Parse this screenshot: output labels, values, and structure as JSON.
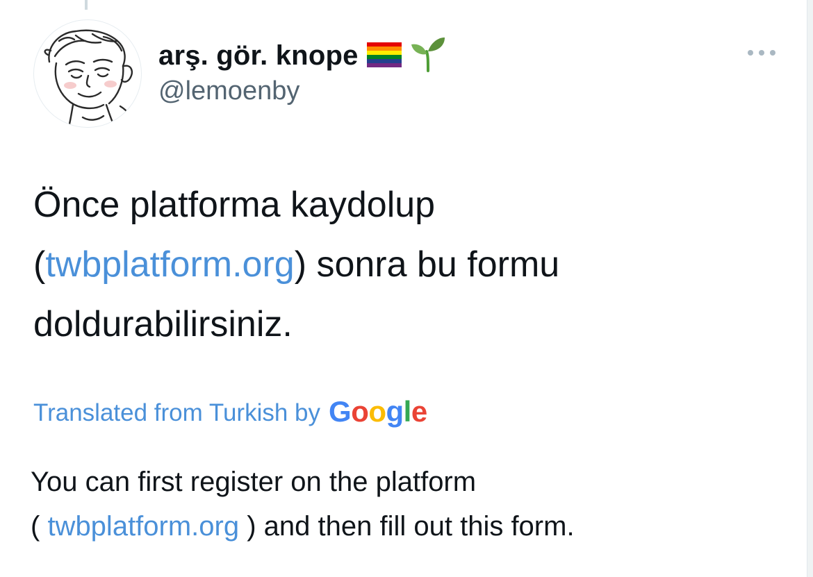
{
  "tweet": {
    "display_name": "arş. gör. knope",
    "name_emojis": [
      "rainbow-flag-icon",
      "seedling-icon"
    ],
    "handle": "@lemoenby",
    "more_icon": "more-horizontal-icon",
    "text_line1": "Önce platforma kaydolup",
    "text_line2_open": "(",
    "text_link": "twbplatform.org",
    "text_line2_close": ") sonra bu formu",
    "text_line3": "doldurabilirsiniz."
  },
  "translation": {
    "label": "Translated from Turkish by",
    "provider_letters": [
      "G",
      "o",
      "o",
      "g",
      "l",
      "e"
    ],
    "line1": "You can first register on the platform",
    "line2_open": "( ",
    "link": "twbplatform.org",
    "line2_close": " ) and then fill out this form."
  },
  "colors": {
    "link": "#4a90d9",
    "text": "#0f1419",
    "secondary": "#536471",
    "google_blue": "#4285f4",
    "google_red": "#ea4335",
    "google_yellow": "#fbbc05",
    "google_green": "#34a853"
  }
}
